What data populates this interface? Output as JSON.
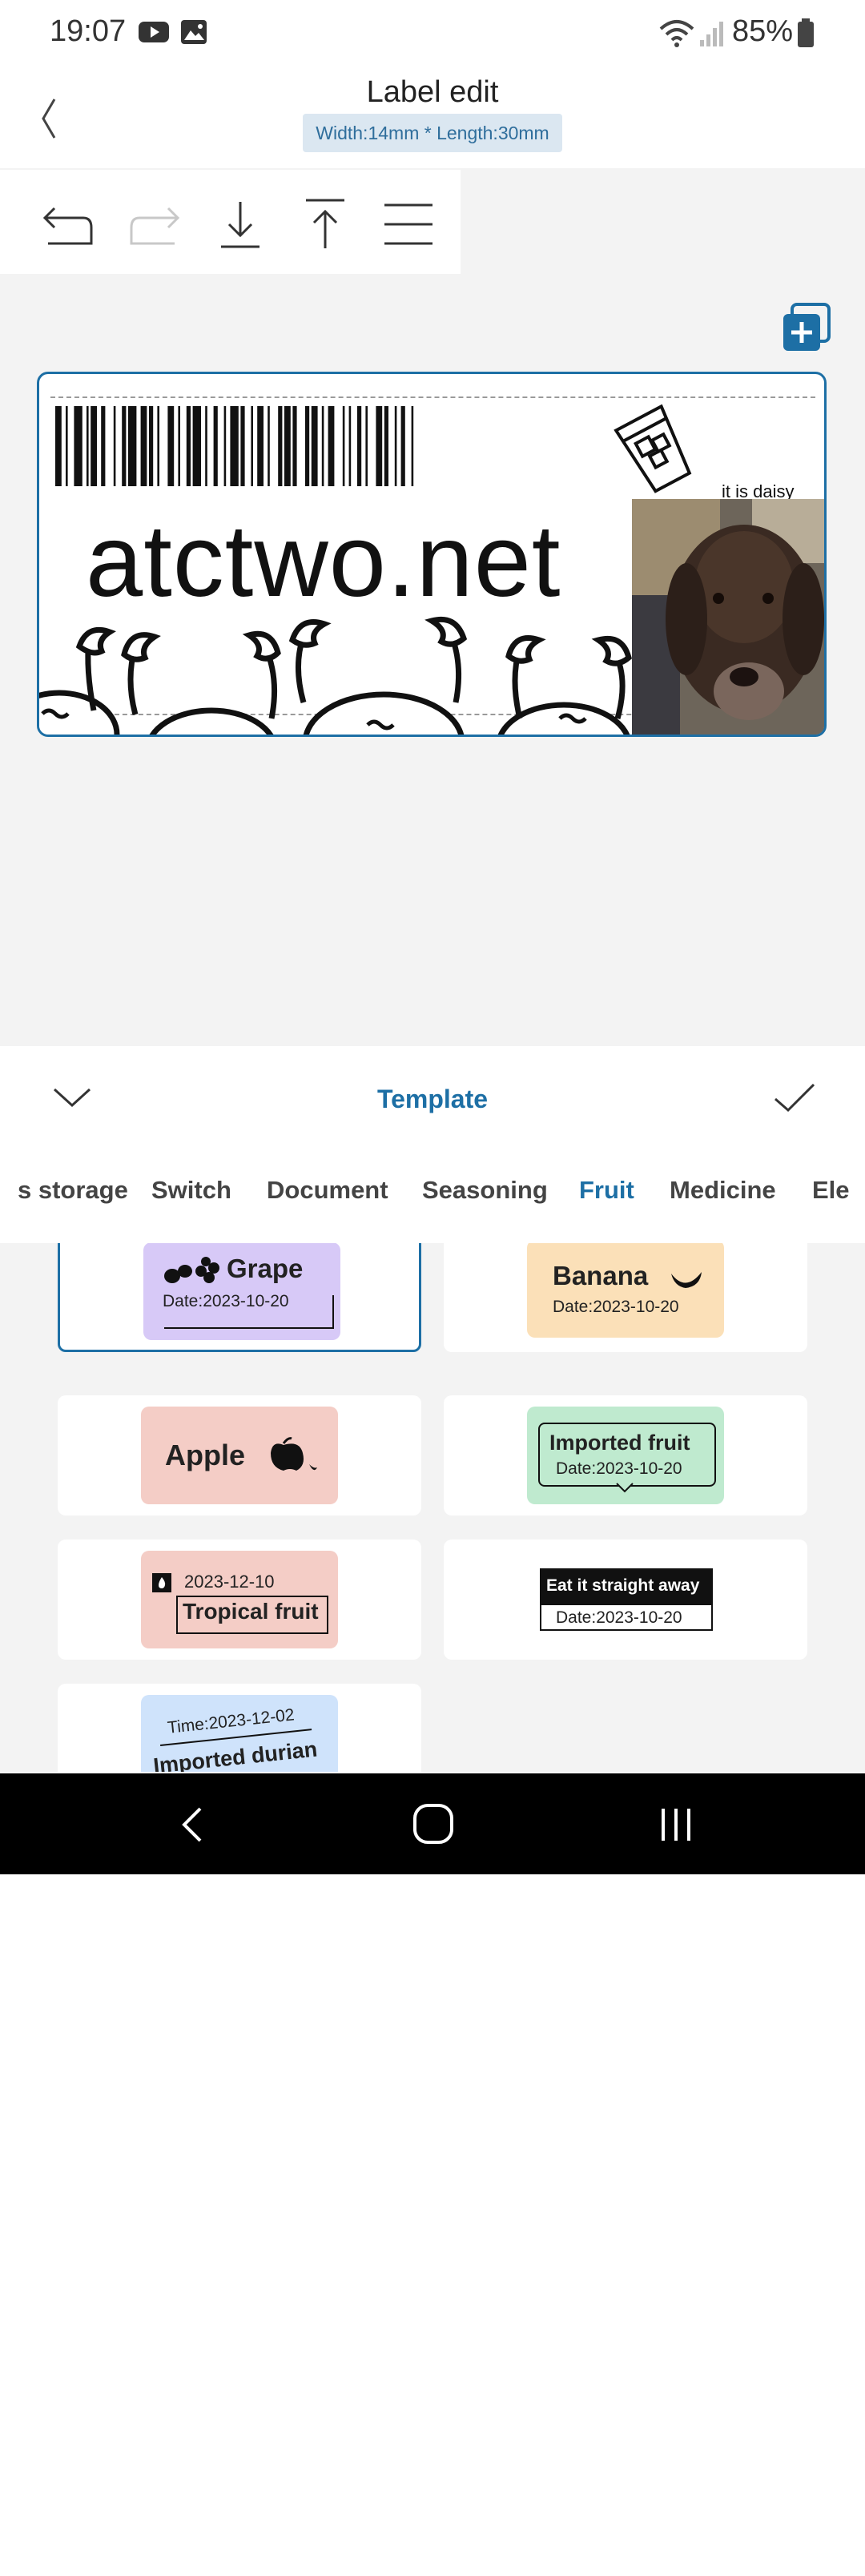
{
  "status": {
    "time": "19:07",
    "battery": "85%"
  },
  "header": {
    "title": "Label edit",
    "dimensions": "Width:14mm * Length:30mm"
  },
  "label": {
    "main_text": "atctwo.net",
    "caption": "it is daisy"
  },
  "panel": {
    "title": "Template",
    "tabs": [
      {
        "label": "s storage"
      },
      {
        "label": "Switch"
      },
      {
        "label": "Document"
      },
      {
        "label": "Seasoning"
      },
      {
        "label": "Fruit"
      },
      {
        "label": "Medicine"
      },
      {
        "label": "Ele"
      }
    ],
    "active_tab": "Fruit"
  },
  "templates": {
    "grape": {
      "title": "Grape",
      "date": "Date:2023-10-20"
    },
    "banana": {
      "title": "Banana",
      "date": "Date:2023-10-20"
    },
    "apple": {
      "title": "Apple"
    },
    "imported": {
      "title": "Imported fruit",
      "date": "Date:2023-10-20"
    },
    "tropical": {
      "date": "2023-12-10",
      "title": "Tropical fruit"
    },
    "eat": {
      "title": "Eat it straight away",
      "date": "Date:2023-10-20"
    },
    "durian": {
      "time": "Time:2023-12-02",
      "title": "Imported durian"
    }
  },
  "colors": {
    "accent": "#1d6fa5",
    "grape_bg": "#d7c9f7",
    "banana_bg": "#fbe0b8",
    "apple_bg": "#f4cdc6",
    "imported_bg": "#bfeacf",
    "durian_bg": "#cfe3fb"
  }
}
